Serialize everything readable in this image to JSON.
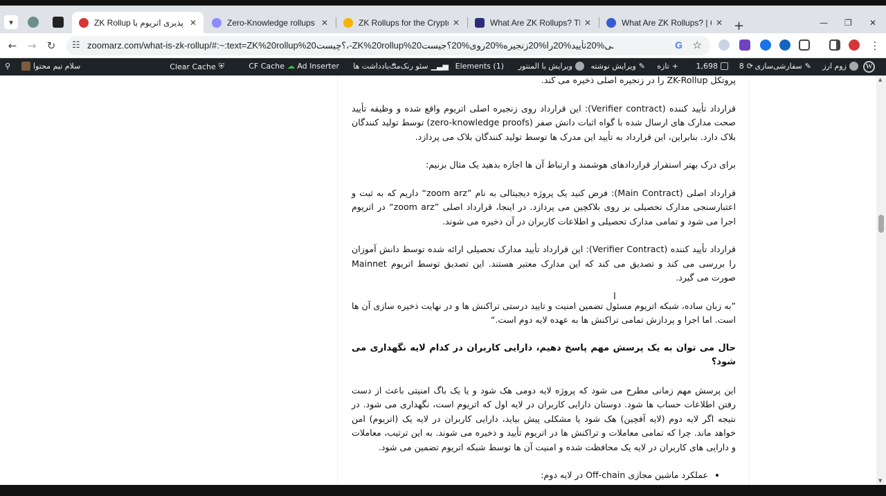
{
  "browser": {
    "tabs": [
      {
        "title": "ZK Rollup مقیاس پذیری اتریوم با ...",
        "fav_color": "#d63638",
        "active": true
      },
      {
        "title": "Zero-Knowledge rollups | ethe",
        "fav_color": "#8c8cff",
        "active": false
      },
      {
        "title": "ZK Rollups for the Crypto Bloc",
        "fav_color": "#f4b400",
        "active": false
      },
      {
        "title": "What Are ZK Rollups? The Futu",
        "fav_color": "#2b2d7c",
        "active": false
      },
      {
        "title": "What Are ZK Rollups? | Chainli",
        "fav_color": "#375bd2",
        "active": false
      }
    ],
    "close_glyph": "✕",
    "new_tab_glyph": "+",
    "url": "zoomarz.com/what-is-zk-rollup/#:~:text=ZK%20rollup%20؟چیست،-ZK%20rollup%20می%20تأیید%20را%20زنجیره%20روی%20؟جیست%E2%80%8Cکنند."
  },
  "adminbar": {
    "right_items": [
      {
        "label": "زوم ارز"
      },
      {
        "label": "سفارشی‌سازی"
      },
      {
        "label": "8"
      },
      {
        "label": "1,698"
      },
      {
        "label": "تازه"
      },
      {
        "label": "ویرایش نوشته"
      },
      {
        "label": "ویرایش با المنتور"
      },
      {
        "label": "Elements (1)"
      },
      {
        "label": "سئو رنک‌مث"
      },
      {
        "label": "یادداشت ها"
      },
      {
        "label": "Ad Inserter"
      },
      {
        "label": "CF Cache"
      },
      {
        "label": "Clear Cache"
      }
    ],
    "greeting": "سلام تیم محتوا"
  },
  "article": {
    "p0": "پروتکل ZK-Rollup را در زنجیره اصلی ذخیره می کند.",
    "p1": "قرارداد تأیید کننده  (Verifier contract): این قرارداد روی زنجیره اصلی اتریوم واقع شده و وظیفه تأیید صحت مدارک های ارسال شده با گواه اثبات دانش صفر (zero-knowledge proofs) توسط تولید کنندگان بلاک دارد. بنابراین، این قرارداد به تأیید این مدرک ها توسط تولید کنندگان بلاک می پردازد.",
    "p2": "برای درک بهتر استقرار قراردادهای هوشمند و ارتباط آن ها اجازه بدهید یک مثال بزنیم:",
    "p3": "قرارداد اصلی  (Main Contract): فرض کنید یک پروژه دیجیتالی به نام ”zoom arz“ داریم که به ثبت و اعتبارسنجی مدارک تحصیلی بر روی بلاکچین می پردازد. در اینجا، قرارداد اصلی ”zoom arz“ در اتریوم اجرا می شود و تمامی مدارک تحصیلی و اطلاعات کاربران در آن ذخیره می شوند.",
    "p4": "قرارداد تأیید کننده (Verifier Contract): این قرارداد تأیید مدارک تحصیلی ارائه شده توسط دانش آموزان را بررسی می کند و تصدیق می کند که این مدارک معتبر هستند. این تصدیق توسط اتریوم Mainnet صورت می گیرد.",
    "p5": "”به زبان ساده، شبکه اتریوم مسئول تضمین امنیت و تایید درستی تراکنش ها و در نهایت ذخیره سازی آن ها است. اما اجرا و پردازش تمامی تراکنش ها به عهده لایه دوم است.“",
    "h1": "حال می توان به یک پرسش مهم پاسخ دهیم، دارایی کاربران در کدام لایه نگهداری می شود؟",
    "p6": "این پرسش مهم زمانی مطرح می شود که پروژه لایه دومی هک شود و یا یک باگ امنیتی باعث از دست رفتن اطلاعات حساب ها شود. دوستان دارایی کاربران در لایه اول که اتریوم است، نگهداری می شود. در نتیجه اگر لایه دوم (لایه آفچین) هک شود یا مشکلی پیش بیاید، دارایی کاربران در لایه یک (اتریوم) امن خواهد ماند. چرا که تمامی معاملات و تراکنش ها در اتریوم تأیید و ذخیره می شوند. به این ترتیب، معاملات و دارایی های کاربران در لایه یک محافظت شده و امنیت آن ها توسط شبکه اتریوم تضمین می شود.",
    "li1": "عملکرد ماشین مجازی Off-chain در لایه دوم:"
  }
}
